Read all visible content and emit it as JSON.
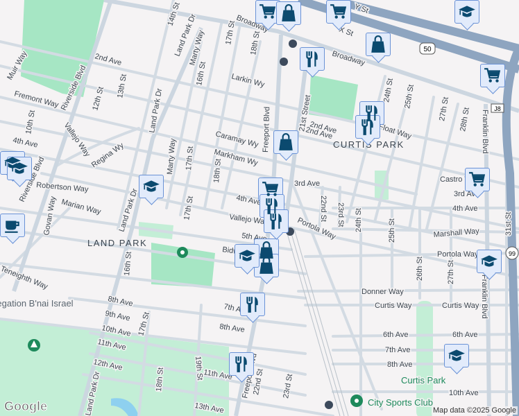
{
  "map": {
    "neighborhoods": [
      "LAND PARK",
      "CURTIS PARK"
    ],
    "places": [
      "Curtis Park",
      "City Sports Club",
      "Congregation B'nai Israel"
    ],
    "streets": [
      "Broadway",
      "Broadway",
      "X St",
      "Y St",
      "14th St",
      "Land Park Dr",
      "Land Park Dr",
      "Land Park Dr",
      "Land Park Dr",
      "Marty Way",
      "Marty Way",
      "16th St",
      "16th St",
      "17th St",
      "17th St",
      "17th St",
      "17th St",
      "18th St",
      "18th St",
      "18th St",
      "2nd Ave",
      "2nd Ave",
      "Larkin Wy",
      "Muir Way",
      "Riverside Blvd",
      "Riverside Blvd",
      "13th St",
      "12th St",
      "Fremont Way",
      "10th St",
      "Vallejo Way",
      "Regina Wy",
      "4th Ave",
      "4th Ave",
      "Caramay Wy",
      "Markham Wy",
      "Freeport Blvd",
      "Freeport Blvd",
      "21st Street",
      "3rd Ave",
      "Castro Way",
      "3rd Ave",
      "4th Ave",
      "22nd St",
      "23rd St",
      "24th St",
      "25th St",
      "26th St",
      "27th St",
      "28th St",
      "27th St",
      "25th St",
      "24th St",
      "31st St",
      "Franklin Blvd",
      "Franklin Blvd",
      "Marshall Way",
      "Portola Way",
      "Portola Way",
      "Donner Way",
      "Curtis Way",
      "Curtis Way",
      "6th Ave",
      "6th Ave",
      "7th Ave",
      "8th Ave",
      "10th Ave",
      "Robertson Way",
      "Marian Way",
      "Govan Way",
      "Teneighth Way",
      "8th Ave",
      "9th Ave",
      "10th Ave",
      "11th Ave",
      "12th Ave",
      "13th Ave",
      "7th Ave",
      "8th Ave",
      "11th Ave",
      "5th Ave",
      "Bidwell Way",
      "Vallejo Way",
      "19th St",
      "22nd St",
      "23rd St",
      "Float Way",
      "2nd Ave"
    ],
    "shields": [
      "50",
      "99",
      "J8"
    ],
    "attribution": "Map data ©2025 Google",
    "logo": "Google"
  },
  "markers": [
    "cart",
    "cart",
    "cart",
    "cart",
    "cart",
    "bag",
    "bag",
    "bag",
    "bag",
    "bag",
    "school",
    "school",
    "school",
    "school",
    "school",
    "school",
    "school",
    "restaurant",
    "restaurant",
    "restaurant",
    "restaurant",
    "restaurant",
    "restaurant",
    "restaurant",
    "cafe"
  ],
  "colors": {
    "marker_fill": "#e2ebfb",
    "marker_border": "#6a92d6",
    "icon": "#0b4a6f",
    "park": "#a6e6c4",
    "freeway": "#8ea5c0"
  }
}
